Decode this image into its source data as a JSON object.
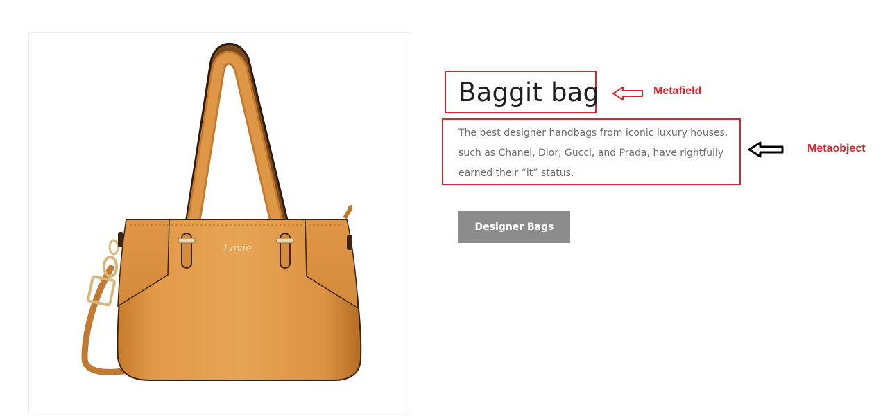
{
  "product": {
    "title": "Baggit bag",
    "description": "The best designer handbags from iconic luxury houses, such as Chanel, Dior, Gucci, and Prada, have rightfully earned their “it” status.",
    "button_label": "Designer Bags",
    "brand_logo": "Lavie"
  },
  "annotations": {
    "metafield_label": "Metafield",
    "metaobject_label": "Metaobject",
    "metafield_arrow_icon": "left-arrow-outline-red",
    "metaobject_arrow_icon": "left-arrow-outline-black"
  },
  "colors": {
    "annotation_red": "#d7262e",
    "button_bg": "#8c8c8c",
    "bag_tan": "#d98f3e"
  }
}
